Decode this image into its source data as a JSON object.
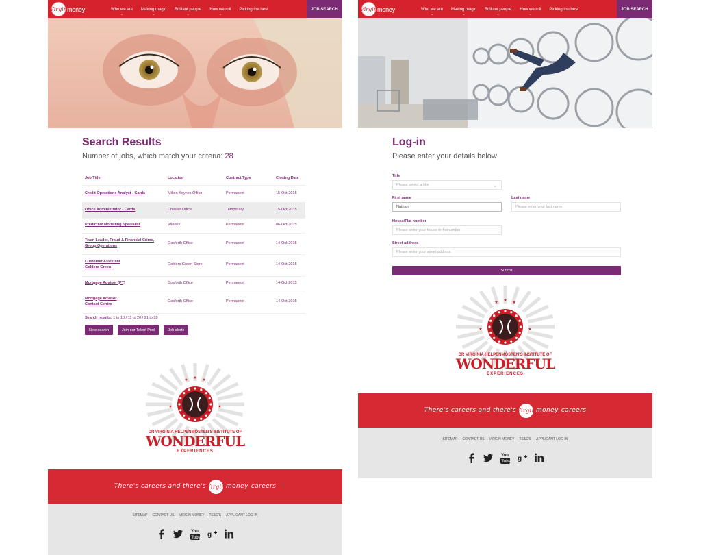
{
  "nav": {
    "logo_text": "Virgin",
    "logo_word": "money",
    "items": [
      {
        "label": "Who we are"
      },
      {
        "label": "Making magic"
      },
      {
        "label": "Brilliant people"
      },
      {
        "label": "How we roll"
      },
      {
        "label": "Picking the best"
      }
    ],
    "job_search": "JOB SEARCH"
  },
  "search": {
    "title": "Search Results",
    "count_prefix": "Number of jobs, which match your criteria:",
    "count": "28",
    "columns": [
      "Job Title",
      "Location",
      "Contract Type",
      "Closing Date"
    ],
    "rows": [
      {
        "title": "Credit Operations Analyst - Cards",
        "location": "Milton Keynes Office",
        "type": "Permanent",
        "date": "15-Oct-2015"
      },
      {
        "title": "Office Administrator - Cards",
        "location": "Chester Office",
        "type": "Temporary",
        "date": "15-Oct-2015"
      },
      {
        "title": "Predictive Modelling Specialist",
        "location": "Various",
        "type": "Permanent",
        "date": "06-Oct-2015"
      },
      {
        "title": "Team Leader, Fraud & Financial Crime, Group Operations",
        "location": "Gosforth Office",
        "type": "Permanent",
        "date": "14-Oct-2015"
      },
      {
        "title": "Customer Assistant Golders Green",
        "location": "Golders Green Store",
        "type": "Permanent",
        "date": "14-Oct-2015"
      },
      {
        "title": "Mortgage Advisor (PT)",
        "location": "Gosforth Office",
        "type": "Permanent",
        "date": "14-Oct-2015"
      },
      {
        "title": "Mortgage Advisor Contact Centre",
        "location": "Gosforth Office",
        "type": "Permanent",
        "date": "14-Oct-2015"
      }
    ],
    "pager_label": "Search results:",
    "pager_pages": "1 to 10 / 11 to 20 / 21 to 28",
    "buttons": [
      "New search",
      "Join our Talent Pool",
      "Job alerts"
    ]
  },
  "login": {
    "title": "Log-in",
    "subtitle": "Please enter your details below",
    "title_label": "Title",
    "title_placeholder": "Please select a title",
    "first_name_label": "First name",
    "first_name_value": "Nathan",
    "last_name_label": "Last name",
    "last_name_placeholder": "Please enter your last name",
    "house_label": "House/Flat number",
    "house_placeholder": "Please enter your house or flatnumber",
    "street_label": "Street address",
    "street_placeholder": "Please enter your street address",
    "submit": "Submit"
  },
  "emblem": {
    "line1": "DR VIRGINIA HELPENMÖSTEN'S INSTITUTE OF",
    "line2": "WONDERFUL",
    "line3": "EXPERIENCES"
  },
  "footer": {
    "tagline_left": "There's careers and there's",
    "tagline_logo": "Virgin",
    "tagline_word": "money",
    "tagline_right": "careers",
    "links": [
      "SITEMAP",
      "CONTACT US",
      "VIRGIN MONEY",
      "TS&C'S",
      "APPLICANT LOG-IN"
    ],
    "social_icons": [
      "facebook-icon",
      "twitter-icon",
      "youtube-icon",
      "google-plus-icon",
      "linkedin-icon"
    ]
  },
  "colors": {
    "brand_red": "#d5222c",
    "brand_purple": "#7b2b73",
    "footer_grey": "#e6e6e6"
  }
}
